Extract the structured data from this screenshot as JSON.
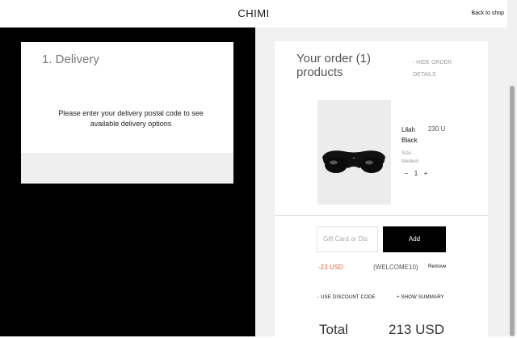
{
  "header": {
    "brand": "CHIMI",
    "back_link": "Back to shop"
  },
  "delivery": {
    "title": "1. Delivery",
    "message": "Please enter your delivery postal code to see available delivery options"
  },
  "order": {
    "title": "Your order (1) products",
    "hide_details": "- HIDE ORDER DETAILS",
    "product": {
      "name": "Lilah Black",
      "price": "230 U",
      "variant": "Size - Medium",
      "quantity": "1",
      "decrease_symbol": "−",
      "increase_symbol": "+",
      "image_icon": "sunglasses-image"
    },
    "gift_placeholder": "Gift Card or Dis",
    "add_button": "Add",
    "discount_amount": "-23 USD",
    "discount_code": "(WELCOME10)",
    "remove": "Remove",
    "use_discount": "- USE DISCOUNT CODE",
    "show_summary": "+ SHOW SUMMARY",
    "total_label": "Total",
    "total_value": "213 USD"
  },
  "colors": {
    "accent": "#e0683c",
    "button": "#000000",
    "panel_bg": "#f1f1f1"
  }
}
